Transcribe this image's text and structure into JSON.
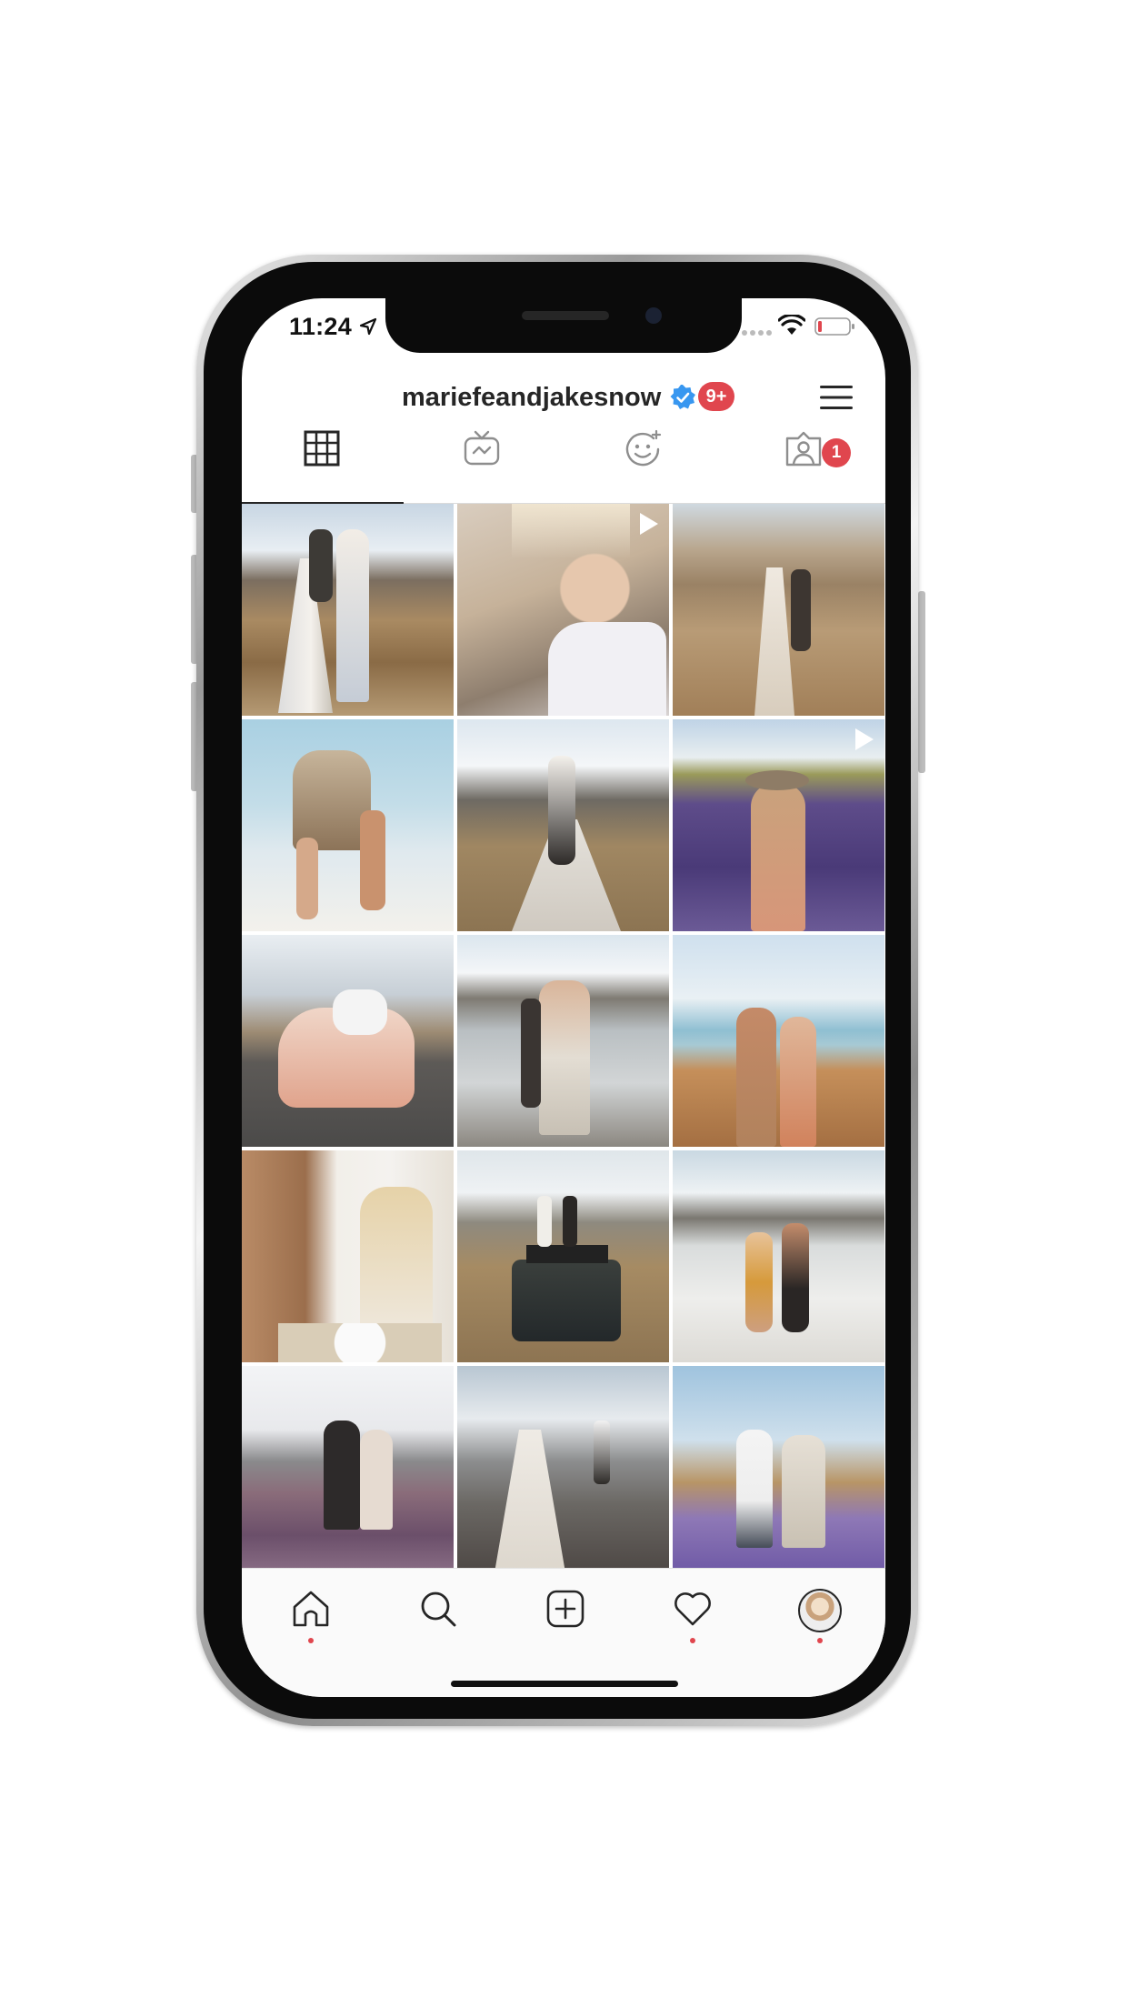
{
  "status_bar": {
    "time": "11:24"
  },
  "profile": {
    "username": "mariefeandjakesnow",
    "notification_badge": "9+",
    "tagged_badge": "1"
  },
  "tabs": [
    {
      "name": "grid",
      "icon": "grid-icon",
      "active": true
    },
    {
      "name": "igtv",
      "icon": "igtv-icon",
      "active": false
    },
    {
      "name": "effects",
      "icon": "face-effects-icon",
      "active": false
    },
    {
      "name": "tagged",
      "icon": "tagged-person-icon",
      "active": false
    }
  ],
  "photos": [
    {
      "scene": "couple-boardwalk-mountains",
      "video": false
    },
    {
      "scene": "woman-car-window",
      "video": true
    },
    {
      "scene": "couple-grassland-valley",
      "video": false
    },
    {
      "scene": "couple-beach-rock",
      "video": false
    },
    {
      "scene": "woman-shoulders-boardwalk",
      "video": false
    },
    {
      "scene": "woman-lavender-field",
      "video": true
    },
    {
      "scene": "couple-road-trees",
      "video": false
    },
    {
      "scene": "couple-glacier-lake",
      "video": false
    },
    {
      "scene": "couple-lake-grass",
      "video": false
    },
    {
      "scene": "couple-flowers-portrait",
      "video": false
    },
    {
      "scene": "couple-truck-mountains",
      "video": false
    },
    {
      "scene": "couple-glacier-water",
      "video": false
    },
    {
      "scene": "couple-lupine-field",
      "video": false
    },
    {
      "scene": "woman-snowy-peaks",
      "video": false
    },
    {
      "scene": "couple-lavender-field",
      "video": false
    }
  ],
  "bottom_nav": [
    {
      "name": "home",
      "icon": "home-icon",
      "dot": true
    },
    {
      "name": "search",
      "icon": "search-icon",
      "dot": false
    },
    {
      "name": "new-post",
      "icon": "add-post-icon",
      "dot": false
    },
    {
      "name": "activity",
      "icon": "heart-icon",
      "dot": true
    },
    {
      "name": "profile",
      "icon": "avatar",
      "dot": true
    }
  ],
  "colors": {
    "badge": "#e0464e",
    "verified": "#3897f0",
    "text": "#262626"
  }
}
